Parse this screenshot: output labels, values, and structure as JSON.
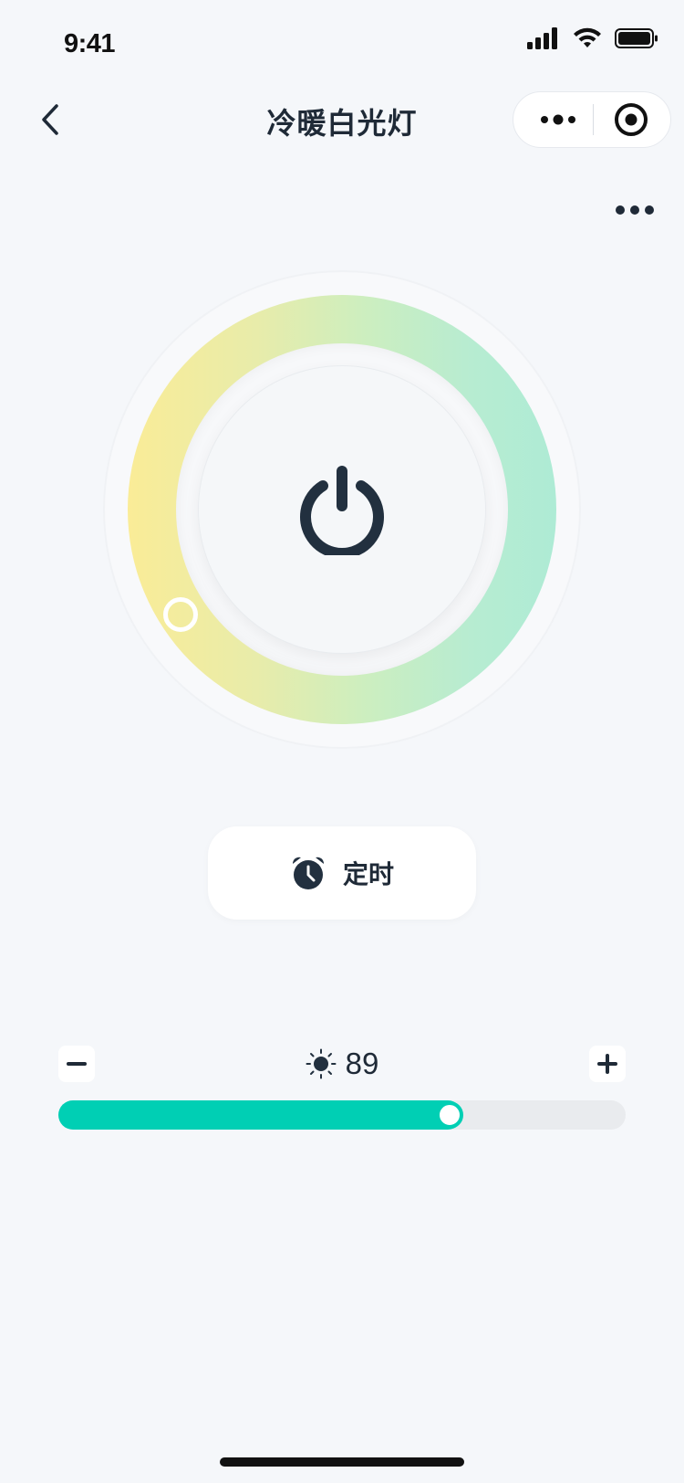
{
  "status_bar": {
    "time": "9:41",
    "icons": [
      "cellular-signal-icon",
      "wifi-icon",
      "battery-icon"
    ]
  },
  "nav": {
    "title": "冷暖白光灯",
    "back_icon": "chevron-left-icon",
    "capsule": {
      "more_icon": "more-dots-icon",
      "close_icon": "target-circle-icon"
    }
  },
  "page_more_icon": "more-dots-icon",
  "dial": {
    "gradient_start": "#faec97",
    "gradient_end": "#aeebd5",
    "power_icon": "power-icon",
    "power_color": "#22303f"
  },
  "timer": {
    "label": "定时",
    "icon": "alarm-clock-icon"
  },
  "brightness": {
    "value": "89",
    "icon": "sun-icon",
    "slider_fraction": 0.69,
    "accent": "#00cfb4",
    "minus_icon": "minus-icon",
    "plus_icon": "plus-icon"
  }
}
